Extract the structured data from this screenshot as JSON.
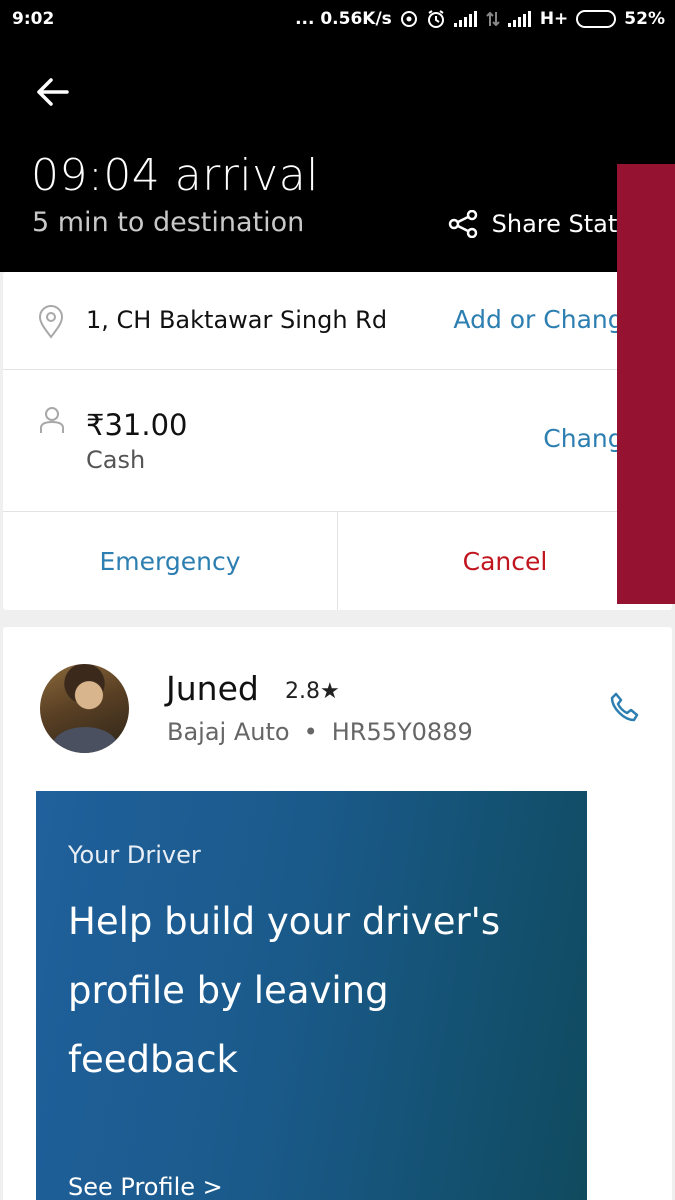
{
  "status_bar": {
    "time": "9:02",
    "network_speed": "... 0.56K/s",
    "network_type": "H+",
    "battery": "52%",
    "battery_level": 0.52
  },
  "header": {
    "arrival": "09:04 arrival",
    "eta": "5 min to destination",
    "share_label": "Share Status"
  },
  "trip": {
    "destination": "1, CH Baktawar Singh Rd",
    "destination_action": "Add or Change",
    "fare": "₹31.00",
    "payment_method": "Cash",
    "payment_action": "Change",
    "emergency_label": "Emergency",
    "cancel_label": "Cancel"
  },
  "driver": {
    "name": "Juned",
    "rating": "2.8★",
    "vehicle_model": "Bajaj Auto",
    "separator": "•",
    "plate": "HR55Y0889"
  },
  "promo": {
    "eyebrow": "Your Driver",
    "headline": "Help build your driver's profile by leaving feedback",
    "link": "See Profile >"
  },
  "colors": {
    "link_blue": "#2d7fb1",
    "cancel_red": "#c0151e",
    "promo_blue": "#20609c",
    "promo_next": "#961231"
  }
}
